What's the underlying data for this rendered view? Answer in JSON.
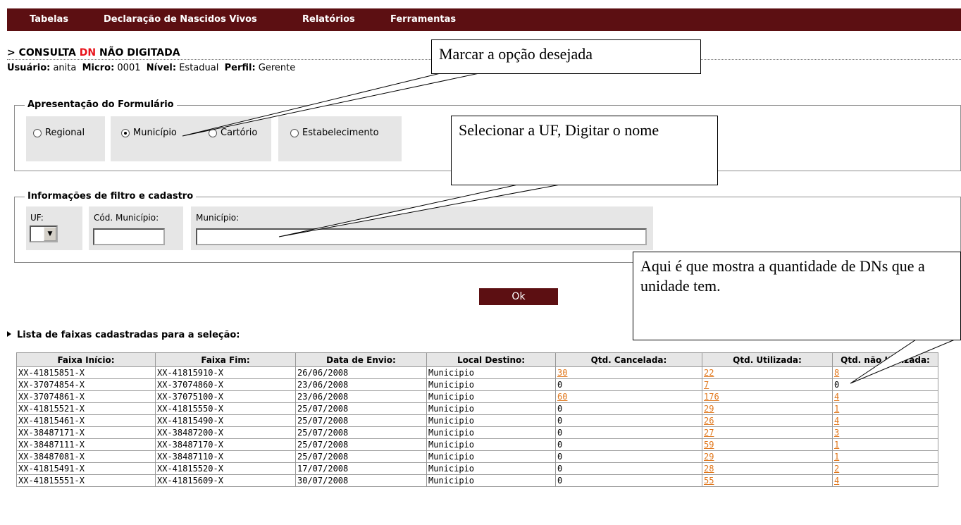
{
  "menu": [
    "Tabelas",
    "Declaração de Nascidos Vivos",
    "Relatórios",
    "Ferramentas"
  ],
  "header": {
    "prefix": "> CONSULTA ",
    "dn": "DN",
    "suffix": " NÃO DIGITADA",
    "user_label": "Usuário:",
    "user": "anita",
    "micro_label": "Micro:",
    "micro": "0001",
    "nivel_label": "Nível:",
    "nivel": "Estadual",
    "perfil_label": "Perfil:",
    "perfil": "Gerente"
  },
  "form": {
    "legend": "Apresentação do Formulário",
    "options": [
      "Regional",
      "Município",
      "Cartório",
      "Estabelecimento"
    ],
    "selected": "Município"
  },
  "filter": {
    "legend": "Informações de filtro e cadastro",
    "uf_label": "UF:",
    "cod_label": "Cód. Município:",
    "mun_label": "Município:",
    "uf_value": "",
    "cod_value": "",
    "mun_value": ""
  },
  "ok_label": "Ok",
  "list_title": "Lista de faixas cadastradas para a seleção:",
  "table": {
    "columns": [
      "Faixa Início:",
      "Faixa Fim:",
      "Data de Envio:",
      "Local Destino:",
      "Qtd. Cancelada:",
      "Qtd. Utilizada:",
      "Qtd. não Utilizada:"
    ],
    "rows": [
      [
        "XX-41815851-X",
        "XX-41815910-X",
        "26/06/2008",
        "Municipio",
        "30",
        "22",
        "8"
      ],
      [
        "XX-37074854-X",
        "XX-37074860-X",
        "23/06/2008",
        "Municipio",
        "0",
        "7",
        "0"
      ],
      [
        "XX-37074861-X",
        "XX-37075100-X",
        "23/06/2008",
        "Municipio",
        "60",
        "176",
        "4"
      ],
      [
        "XX-41815521-X",
        "XX-41815550-X",
        "25/07/2008",
        "Municipio",
        "0",
        "29",
        "1"
      ],
      [
        "XX-41815461-X",
        "XX-41815490-X",
        "25/07/2008",
        "Municipio",
        "0",
        "26",
        "4"
      ],
      [
        "XX-38487171-X",
        "XX-38487200-X",
        "25/07/2008",
        "Municipio",
        "0",
        "27",
        "3"
      ],
      [
        "XX-38487111-X",
        "XX-38487170-X",
        "25/07/2008",
        "Municipio",
        "0",
        "59",
        "1"
      ],
      [
        "XX-38487081-X",
        "XX-38487110-X",
        "25/07/2008",
        "Municipio",
        "0",
        "29",
        "1"
      ],
      [
        "XX-41815491-X",
        "XX-41815520-X",
        "17/07/2008",
        "Municipio",
        "0",
        "28",
        "2"
      ],
      [
        "XX-41815551-X",
        "XX-41815609-X",
        "30/07/2008",
        "Municipio",
        "0",
        "55",
        "4"
      ]
    ]
  },
  "callouts": {
    "c1": "Marcar a opção desejada",
    "c2": "Selecionar a UF, Digitar o nome",
    "c3": "Aqui é que mostra a quantidade de DNs que a unidade tem."
  },
  "colors": {
    "menu_bg": "#5c0f12",
    "link": "#e0761a",
    "dn_red": "#e8121a",
    "panel": "#e6e6e6"
  }
}
